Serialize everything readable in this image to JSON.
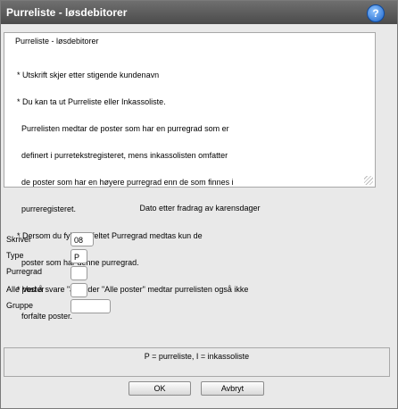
{
  "window": {
    "title": "Purreliste - løsdebitorer",
    "help_icon": "?"
  },
  "info": {
    "heading": "Purreliste - løsdebitorer",
    "lines": [
      "* Utskrift skjer etter stigende kundenavn",
      "* Du kan ta ut Purreliste eller Inkassoliste.",
      "  Purrelisten medtar de poster som har en purregrad som er",
      "  definert i purretekstregisteret, mens inkassolisten omfatter",
      "  de poster som har en høyere purregrad enn de som finnes i",
      "  purreregisteret.",
      "* Dersom du fyller ut feltet Purregrad medtas kun de",
      "  poster som har denne purregrad.",
      "* Ved å svare \"J\" under \"Alle poster\" medtar purrelisten også ikke",
      "  forfalte poster."
    ]
  },
  "subtitle": "Dato etter fradrag av karensdager",
  "form": {
    "skriver": {
      "label": "Skriver",
      "value": "08"
    },
    "type": {
      "label": "Type",
      "value": "P"
    },
    "purregrad": {
      "label": "Purregrad",
      "value": ""
    },
    "alle_poster": {
      "label": "Alle poster",
      "value": ""
    },
    "gruppe": {
      "label": "Gruppe",
      "value": ""
    }
  },
  "status": "P = purreliste,    I = inkassoliste",
  "buttons": {
    "ok": "OK",
    "cancel": "Avbryt"
  }
}
